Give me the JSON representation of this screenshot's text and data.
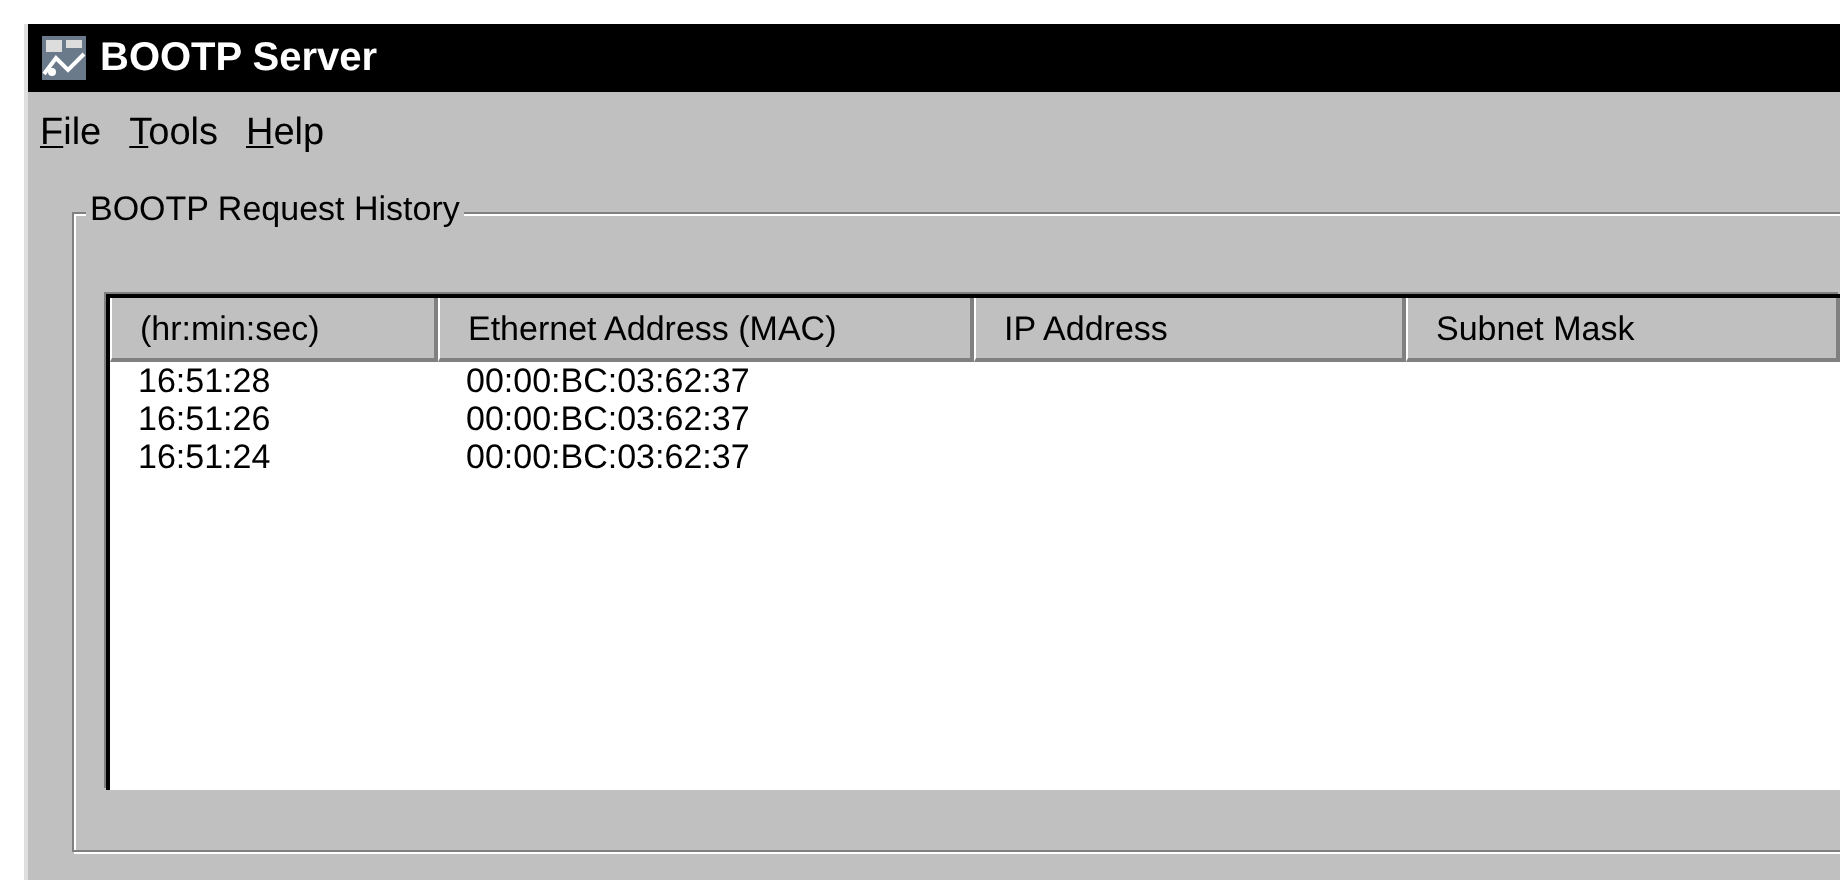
{
  "window": {
    "title": "BOOTP Server"
  },
  "menu": [
    {
      "label": "File",
      "underlined_initial": true
    },
    {
      "label": "Tools",
      "underlined_initial": true
    },
    {
      "label": "Help",
      "underlined_initial": true
    }
  ],
  "group": {
    "title": "BOOTP Request History"
  },
  "table": {
    "columns": [
      "(hr:min:sec)",
      "Ethernet Address (MAC)",
      "IP Address",
      "Subnet Mask"
    ],
    "rows": [
      [
        "16:51:28",
        "00:00:BC:03:62:37"
      ],
      [
        "16:51:26",
        "00:00:BC:03:62:37"
      ],
      [
        "16:51:24",
        "00:00:BC:03:62:37"
      ]
    ]
  }
}
